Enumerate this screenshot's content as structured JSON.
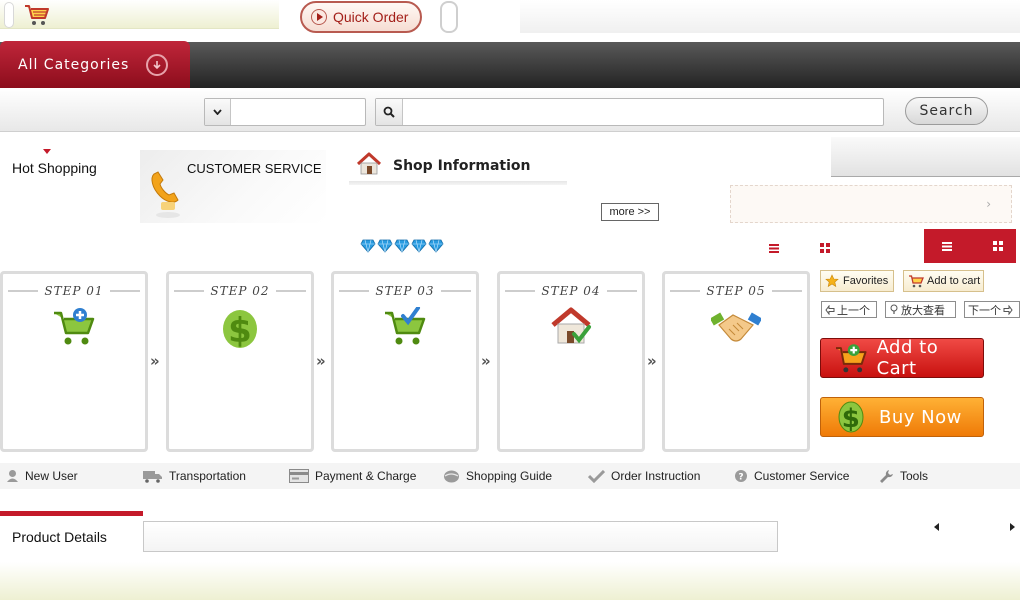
{
  "header": {
    "quick_order_label": "Quick Order",
    "all_categories_label": "All Categories"
  },
  "search": {
    "category_value": "",
    "keyword_value": "",
    "button_label": "Search"
  },
  "middle": {
    "hot_shopping_label": "Hot Shopping",
    "customer_service_label": "CUSTOMER SERVICE",
    "shop_information_label": "Shop Information",
    "more_label": "more >>",
    "pink_arrow": "›"
  },
  "steps": [
    {
      "label": "STEP 01",
      "icon": "cart-add-icon"
    },
    {
      "label": "STEP 02",
      "icon": "dollar-icon"
    },
    {
      "label": "STEP 03",
      "icon": "cart-check-icon"
    },
    {
      "label": "STEP 04",
      "icon": "house-check-icon"
    },
    {
      "label": "STEP 05",
      "icon": "handshake-icon"
    }
  ],
  "step_arrow": "»",
  "actions": {
    "favorites_label": "Favorites",
    "add_to_cart_small_label": "Add to cart",
    "prev_label": "上一个",
    "zoom_label": "放大查看",
    "next_label": "下一个",
    "add_to_cart_label": "Add to Cart",
    "buy_now_label": "Buy Now"
  },
  "bottom_menu": [
    {
      "label": "New User",
      "icon": "user-icon"
    },
    {
      "label": "Transportation",
      "icon": "truck-icon"
    },
    {
      "label": "Payment & Charge",
      "icon": "card-icon"
    },
    {
      "label": "Shopping Guide",
      "icon": "globe-icon"
    },
    {
      "label": "Order Instruction",
      "icon": "check-icon"
    },
    {
      "label": "Customer Service",
      "icon": "help-icon"
    },
    {
      "label": "Tools",
      "icon": "wrench-icon"
    }
  ],
  "product": {
    "tab_label": "Product Details"
  },
  "colors": {
    "brand_red": "#c41a2a",
    "buy_orange": "#ef7a07",
    "green_icon": "#6fb22e"
  }
}
